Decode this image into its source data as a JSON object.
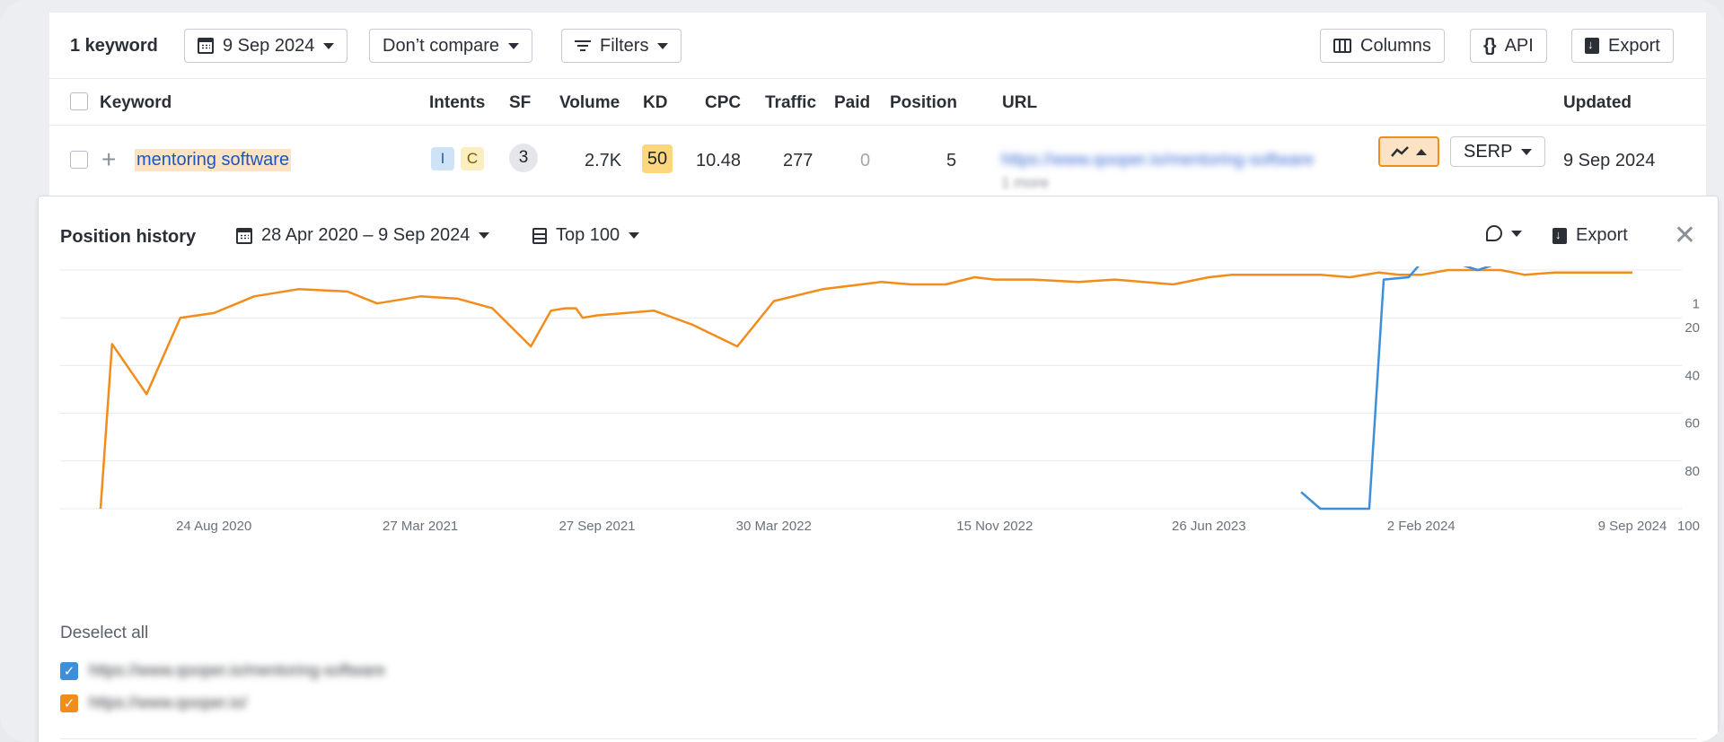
{
  "toolbar": {
    "keyword_count": "1 keyword",
    "date": "9 Sep 2024",
    "compare": "Don’t compare",
    "filters": "Filters",
    "columns": "Columns",
    "api": "API",
    "export": "Export"
  },
  "table": {
    "headers": {
      "keyword": "Keyword",
      "intents": "Intents",
      "sf": "SF",
      "volume": "Volume",
      "kd": "KD",
      "cpc": "CPC",
      "traffic": "Traffic",
      "paid": "Paid",
      "position": "Position",
      "url": "URL",
      "updated": "Updated"
    },
    "row": {
      "keyword": "mentoring software",
      "intent_i": "I",
      "intent_c": "C",
      "sf": "3",
      "volume": "2.7K",
      "kd": "50",
      "cpc": "10.48",
      "traffic": "277",
      "paid": "0",
      "position": "5",
      "url": "https://www.qooper.io/mentoring-software",
      "url_more": "1 more",
      "serp": "SERP",
      "updated": "9 Sep 2024"
    }
  },
  "panel": {
    "title": "Position history",
    "date_range": "28 Apr 2020 – 9 Sep 2024",
    "top": "Top 100",
    "export": "Export",
    "deselect": "Deselect all",
    "legend": [
      {
        "url": "https://www.qooper.io/mentoring-software",
        "color": "#3d8fd9"
      },
      {
        "url": "https://www.qooper.io/",
        "color": "#f28c1b"
      }
    ]
  },
  "chart_data": {
    "type": "line",
    "x_ticks": [
      "24 Aug 2020",
      "27 Mar 2021",
      "27 Sep 2021",
      "30 Mar 2022",
      "15 Nov 2022",
      "26 Jun 2023",
      "2 Feb 2024",
      "9 Sep 2024"
    ],
    "y_ticks": [
      "1",
      "20",
      "40",
      "60",
      "80",
      "100"
    ],
    "ylim": [
      100,
      0
    ],
    "grid": true,
    "series": [
      {
        "color": "#f28c1b",
        "x": [
          "2020-04-28",
          "2020-05-10",
          "2020-06-15",
          "2020-07-20",
          "2020-08-24",
          "2020-10-05",
          "2020-11-20",
          "2021-01-10",
          "2021-02-10",
          "2021-03-27",
          "2021-05-05",
          "2021-06-10",
          "2021-07-20",
          "2021-08-10",
          "2021-08-25",
          "2021-09-05",
          "2021-09-12",
          "2021-09-27",
          "2021-11-25",
          "2022-01-05",
          "2022-02-20",
          "2022-03-30",
          "2022-05-20",
          "2022-07-20",
          "2022-08-20",
          "2022-09-25",
          "2022-10-25",
          "2022-11-15",
          "2022-12-25",
          "2023-02-10",
          "2023-03-20",
          "2023-05-20",
          "2023-06-26",
          "2023-07-20",
          "2023-08-20",
          "2023-10-20",
          "2023-11-20",
          "2023-12-20",
          "2024-01-10",
          "2024-02-02",
          "2024-03-01",
          "2024-04-01",
          "2024-04-25",
          "2024-05-20",
          "2024-06-20",
          "2024-07-25",
          "2024-09-09"
        ],
        "values": [
          100,
          31,
          52,
          20,
          18,
          11,
          8,
          9,
          14,
          11,
          12,
          16,
          32,
          17,
          16,
          16,
          20,
          19,
          17,
          23,
          32,
          13,
          8,
          5,
          6,
          6,
          3,
          4,
          4,
          5,
          4,
          6,
          3,
          2,
          2,
          2,
          3,
          1,
          2,
          2,
          0,
          0,
          0,
          2,
          1,
          1,
          1
        ]
      },
      {
        "color": "#3d8fd9",
        "x": [
          "2023-09-30",
          "2023-10-20",
          "2023-12-10",
          "2023-12-25",
          "2024-01-20",
          "2024-02-02",
          "2024-03-01",
          "2024-04-01",
          "2024-05-01",
          "2024-06-01",
          "2024-07-01",
          "2024-08-01",
          "2024-09-09"
        ],
        "values": [
          93,
          100,
          100,
          4,
          3,
          -3,
          -4,
          0,
          -4,
          -3,
          -3,
          -2,
          -2
        ]
      }
    ]
  }
}
